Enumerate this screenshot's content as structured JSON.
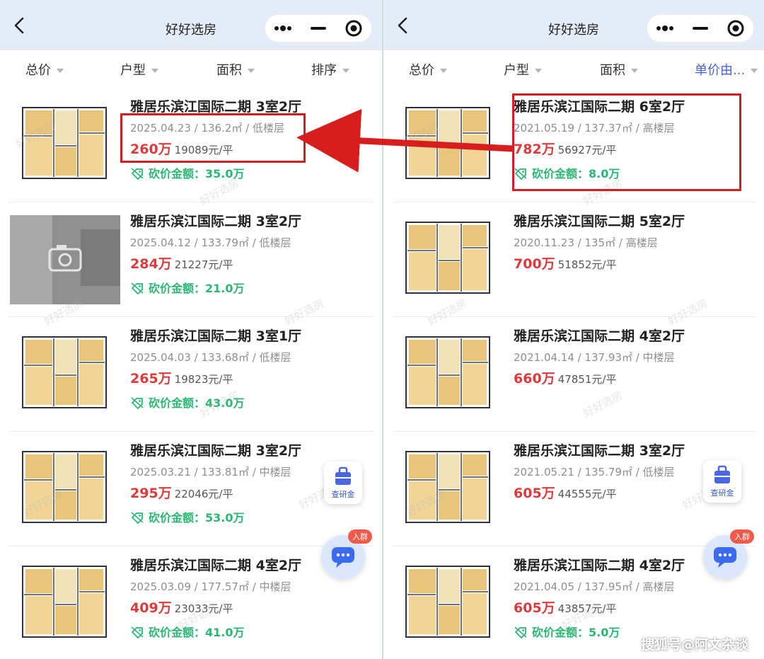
{
  "colors": {
    "price": "#dd3b3b",
    "cut": "#2bb673",
    "active_filter": "#4b62d6",
    "highlight": "#d71e1e"
  },
  "left": {
    "title": "好好选房",
    "filters": [
      "总价",
      "户型",
      "面积",
      "排序"
    ],
    "listings": [
      {
        "title": "雅居乐滨江国际二期 3室2厅",
        "meta": "2025.04.23 / 136.2㎡ / 低楼层",
        "price": "260万",
        "unit_price": "19089元/平",
        "cut": "砍价金额：35.0万",
        "thumb": "floorplan"
      },
      {
        "title": "雅居乐滨江国际二期 3室2厅",
        "meta": "2025.04.12 / 133.79㎡ / 低楼层",
        "price": "284万",
        "unit_price": "21227元/平",
        "cut": "砍价金额：21.0万",
        "thumb": "photo-placeholder"
      },
      {
        "title": "雅居乐滨江国际二期 3室1厅",
        "meta": "2025.04.03 / 133.68㎡ / 低楼层",
        "price": "265万",
        "unit_price": "19823元/平",
        "cut": "砍价金额：43.0万",
        "thumb": "floorplan"
      },
      {
        "title": "雅居乐滨江国际二期 3室2厅",
        "meta": "2025.03.21 / 133.81㎡ / 中楼层",
        "price": "295万",
        "unit_price": "22046元/平",
        "cut": "砍价金额：53.0万",
        "thumb": "floorplan"
      },
      {
        "title": "雅居乐滨江国际二期 4室2厅",
        "meta": "2025.03.09 / 177.57㎡ / 中楼层",
        "price": "409万",
        "unit_price": "23033元/平",
        "cut": "砍价金额：41.0万",
        "thumb": "floorplan"
      }
    ],
    "float_finance": "查研金",
    "chat_badge": "入群"
  },
  "right": {
    "title": "好好选房",
    "filters": [
      "总价",
      "户型",
      "面积",
      "单价由..."
    ],
    "listings": [
      {
        "title": "雅居乐滨江国际二期 6室2厅",
        "meta": "2021.05.19 / 137.37㎡ / 高楼层",
        "price": "782万",
        "unit_price": "56927元/平",
        "cut": "砍价金额：8.0万",
        "thumb": "floorplan"
      },
      {
        "title": "雅居乐滨江国际二期 5室2厅",
        "meta": "2020.11.23 / 135㎡ / 高楼层",
        "price": "700万",
        "unit_price": "51852元/平",
        "cut": "",
        "thumb": "floorplan"
      },
      {
        "title": "雅居乐滨江国际二期 4室2厅",
        "meta": "2021.04.14 / 137.93㎡ / 中楼层",
        "price": "660万",
        "unit_price": "47851元/平",
        "cut": "",
        "thumb": "floorplan"
      },
      {
        "title": "雅居乐滨江国际二期 3室2厅",
        "meta": "2021.05.21 / 135.79㎡ / 低楼层",
        "price": "605万",
        "unit_price": "44555元/平",
        "cut": "",
        "thumb": "floorplan"
      },
      {
        "title": "雅居乐滨江国际二期 4室2厅",
        "meta": "2021.04.05 / 137.95㎡ / 高楼层",
        "price": "605万",
        "unit_price": "43857元/平",
        "cut": "砍价金额：5.0万",
        "thumb": "floorplan"
      }
    ],
    "float_finance": "查研金",
    "chat_badge": "入群"
  },
  "watermark_text": "好好选房",
  "source_credit": "搜狐号@阿文杂谈"
}
